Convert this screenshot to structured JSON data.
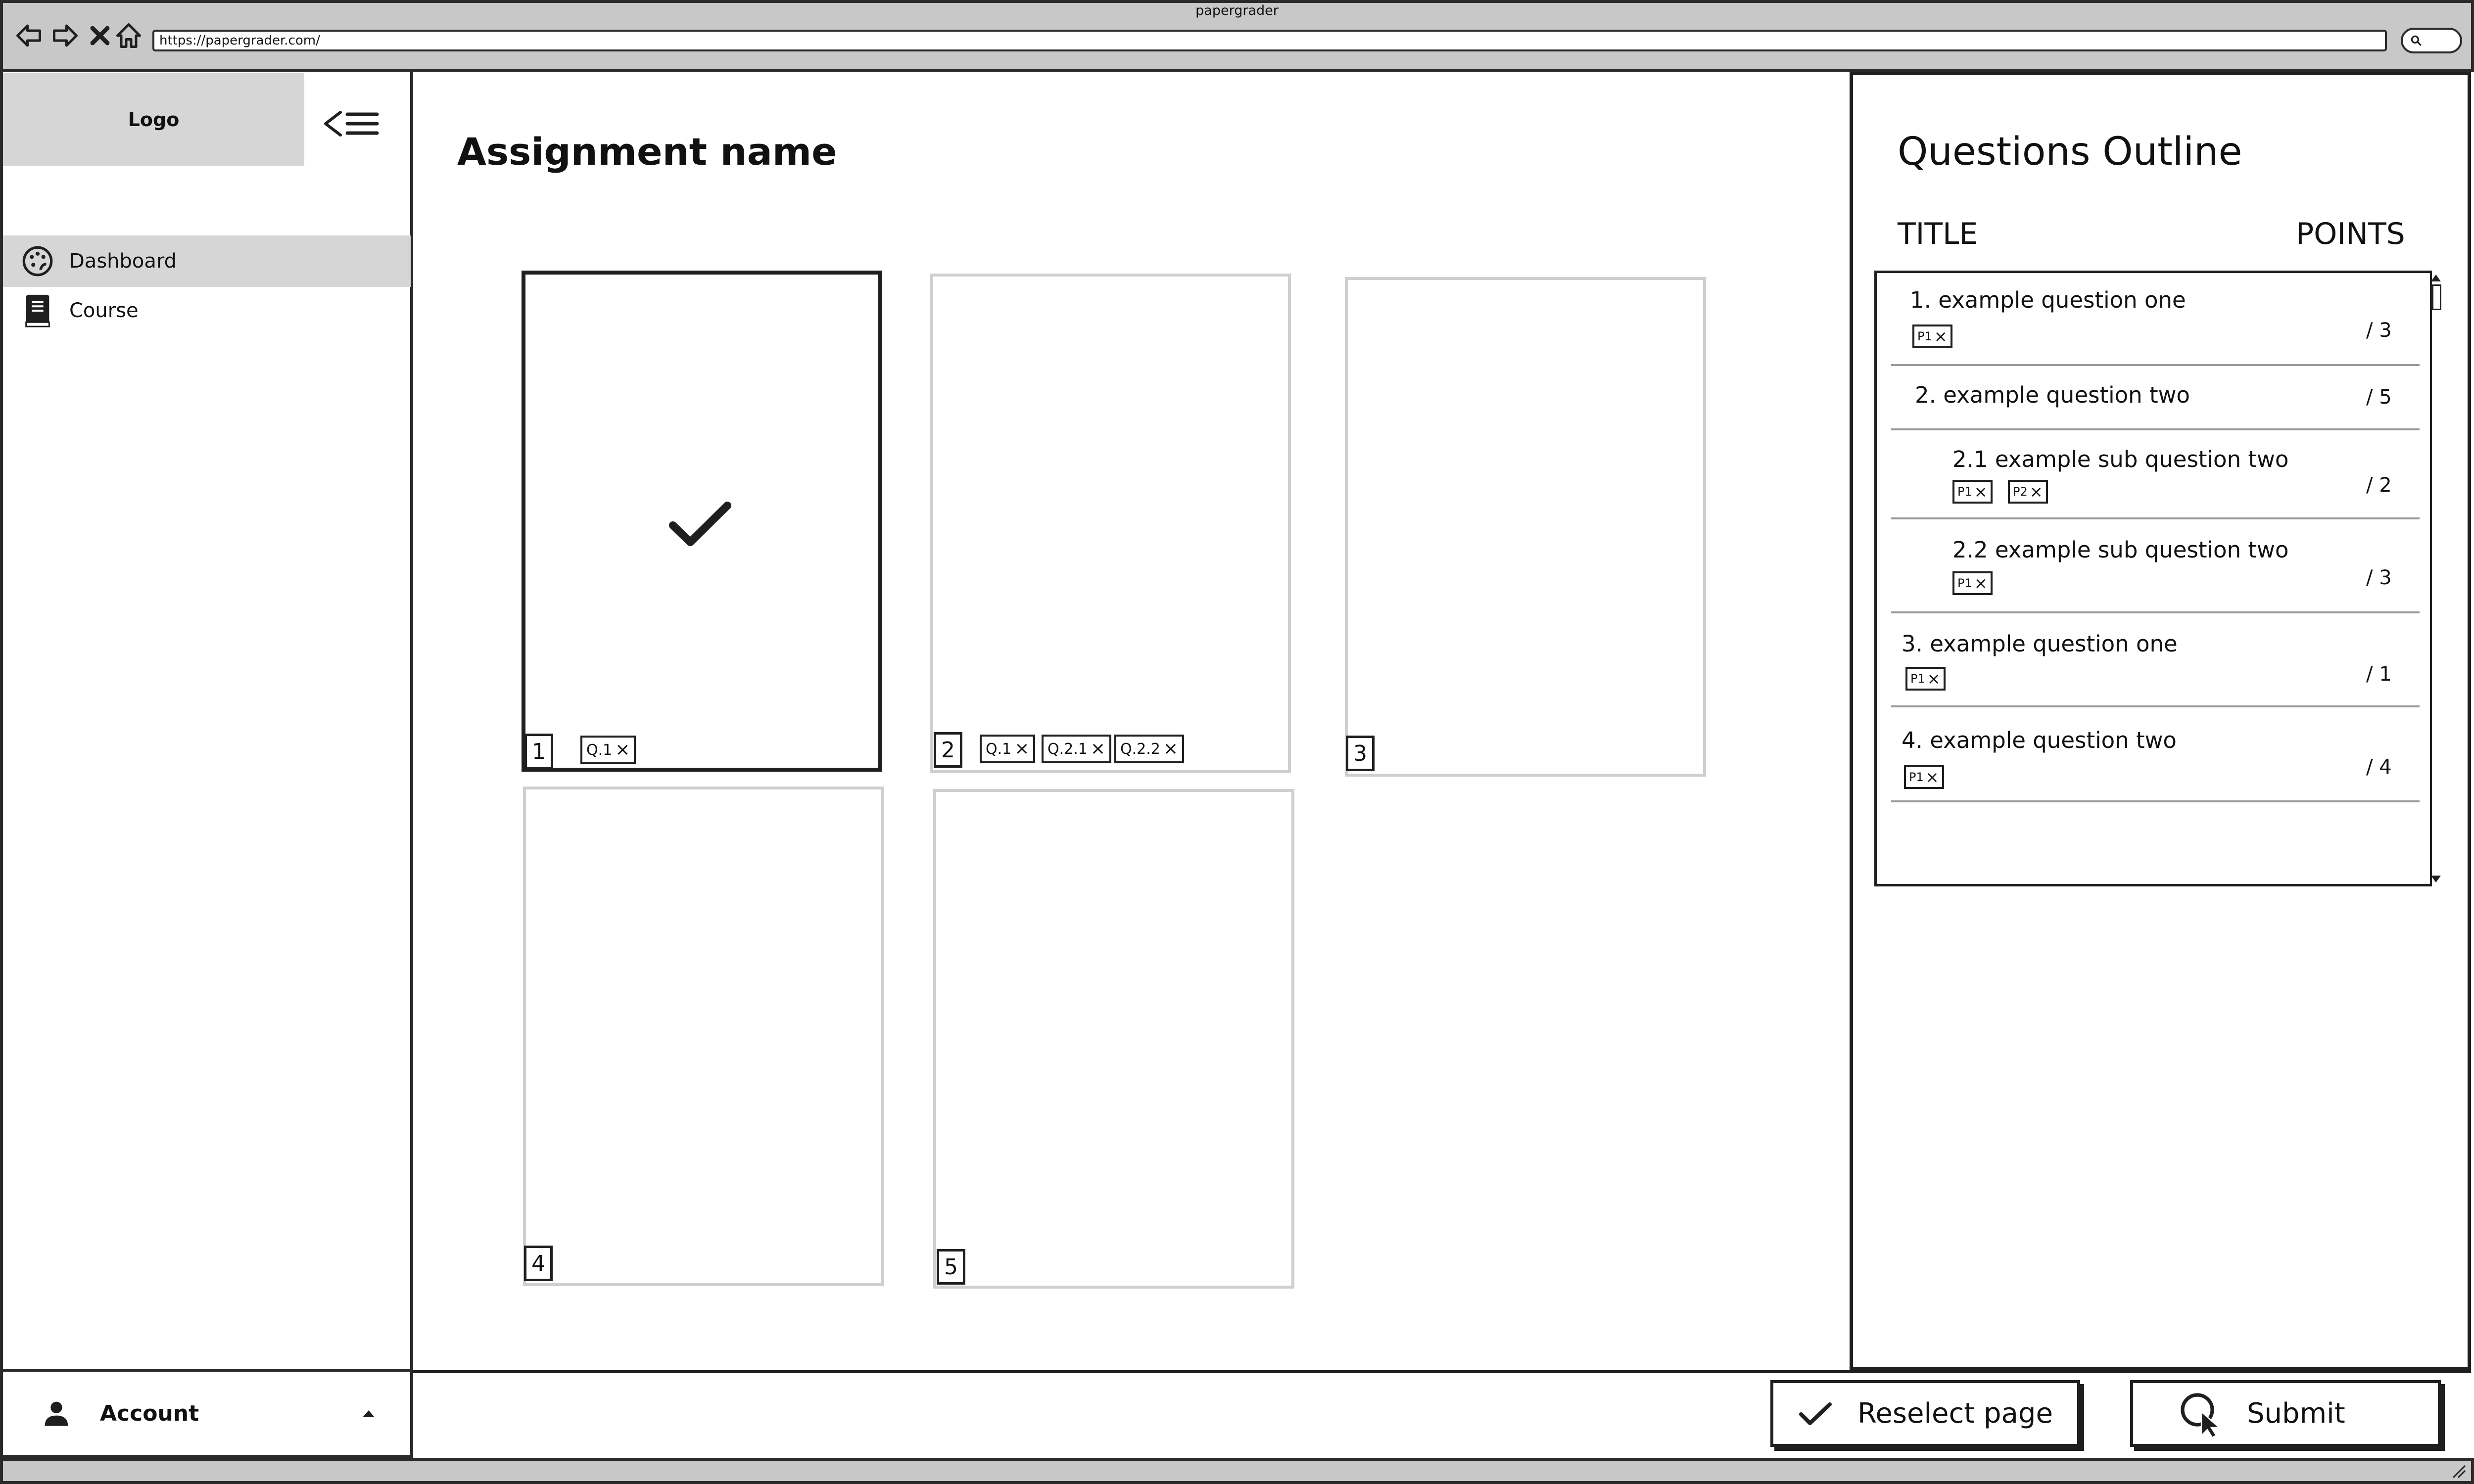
{
  "browser": {
    "title": "papergrader",
    "url": "https://papergrader.com/"
  },
  "sidebar": {
    "logo": "Logo",
    "toggle_label": "<☰",
    "items": [
      {
        "label": "Dashboard",
        "icon": "palette-icon",
        "active": true
      },
      {
        "label": "Course",
        "icon": "book-icon",
        "active": false
      }
    ],
    "account_label": "Account"
  },
  "main": {
    "title": "Assignment name",
    "pages": [
      {
        "number": "1",
        "selected": true,
        "tags": [
          "Q.1"
        ]
      },
      {
        "number": "2",
        "selected": false,
        "tags": [
          "Q.1",
          "Q.2.1",
          "Q.2.2"
        ]
      },
      {
        "number": "3",
        "selected": false,
        "tags": []
      },
      {
        "number": "4",
        "selected": false,
        "tags": []
      },
      {
        "number": "5",
        "selected": false,
        "tags": []
      }
    ]
  },
  "outline": {
    "title": "Questions Outline",
    "col_title": "TITLE",
    "col_points": "POINTS",
    "questions": [
      {
        "text": "1. example question one",
        "points": "/ 3",
        "tags": [
          "P1"
        ]
      },
      {
        "text": "2. example question two",
        "points": "/ 5",
        "tags": []
      },
      {
        "text": "2.1 example sub question two",
        "points": "/ 2",
        "tags": [
          "P1",
          "P2"
        ]
      },
      {
        "text": "2.2 example sub question two",
        "points": "/ 3",
        "tags": [
          "P1"
        ]
      },
      {
        "text": "3. example question one",
        "points": "/ 1",
        "tags": [
          "P1"
        ]
      },
      {
        "text": "4. example question two",
        "points": "/ 4",
        "tags": [
          "P1"
        ]
      }
    ]
  },
  "actions": {
    "reselect_label": "Reselect page",
    "submit_label": "Submit"
  }
}
